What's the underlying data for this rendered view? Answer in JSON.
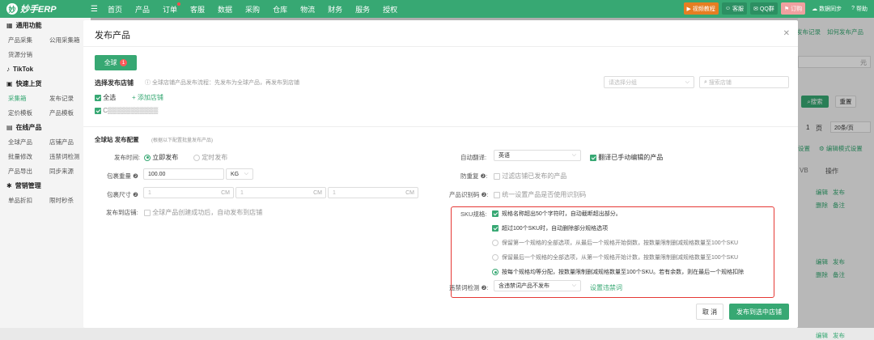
{
  "app": {
    "logo_text": "妙手ERP",
    "logo_mark": "妙"
  },
  "topnav": [
    "首页",
    "产品",
    "订单",
    "客服",
    "数据",
    "采购",
    "仓库",
    "物流",
    "财务",
    "服务",
    "授权"
  ],
  "topright": {
    "video": "视频教程",
    "kefu": "客服",
    "qq": "QQ群",
    "order": "订购",
    "sync": "数据同步",
    "help": "帮助"
  },
  "sidebar": {
    "rows": [
      {
        "type": "sec",
        "label": "通用功能",
        "icon": "grid-icon"
      },
      {
        "type": "row",
        "a": "产品采集",
        "b": "公用采集箱"
      },
      {
        "type": "row",
        "a": "货源分销",
        "b": ""
      },
      {
        "type": "sec",
        "label": "TikTok",
        "icon": "tiktok-icon"
      },
      {
        "type": "sec",
        "label": "快速上货",
        "icon": "store-icon"
      },
      {
        "type": "row",
        "a": "采集箱",
        "b": "发布记录",
        "active": true
      },
      {
        "type": "row",
        "a": "定价模板",
        "b": "产品模板"
      },
      {
        "type": "sec",
        "label": "在线产品",
        "icon": "box-icon"
      },
      {
        "type": "row",
        "a": "全球产品",
        "b": "店铺产品"
      },
      {
        "type": "row",
        "a": "批量修改",
        "b": "违禁词检测"
      },
      {
        "type": "row",
        "a": "产品导出",
        "b": "同步来源"
      },
      {
        "type": "sec",
        "label": "营销管理",
        "icon": "marketing-icon"
      },
      {
        "type": "row",
        "a": "单品折扣",
        "b": "限时秒杀"
      }
    ]
  },
  "bgright": {
    "records": "发布记录",
    "howto": "如何发布产品",
    "unit": "元",
    "search": "搜索",
    "reset": "重置",
    "page": "1",
    "page_unit": "页",
    "per_page": "20条/页",
    "settings": "设置",
    "edit_mode": "编辑模式设置",
    "op_col": "操作",
    "col_v": "VB",
    "actions": [
      [
        "编辑",
        "发布"
      ],
      [
        "删除",
        "备注"
      ]
    ]
  },
  "modal": {
    "title": "发布产品",
    "tab_label": "全球",
    "tab_badge": "1",
    "shop_section_label": "选择发布店铺",
    "shop_hint": "全球店铺产品发布流程：先发布为全球产品，再发布到店铺",
    "group_placeholder": "请选择分组",
    "shop_search_placeholder": "搜索店铺",
    "select_all": "全选",
    "add_shop": "+ 添加店铺",
    "shop_name": "C▒▒▒▒▒▒▒▒▒▒▒",
    "config_title": "全球站 发布配置",
    "config_hint": "(根据以下配置批量发布产品)",
    "publish_time_label": "发布时间:",
    "publish_now": "立即发布",
    "publish_scheduled": "定时发布",
    "weight_label": "包裹重量",
    "weight_value": "100.00",
    "weight_unit": "KG",
    "size_label": "包裹尺寸",
    "size_unit": "CM",
    "size_placeholder": "1",
    "to_shop_label": "发布到店铺:",
    "to_shop_text": "全球产品创建成功后，自动发布到店铺",
    "auto_translate_label": "自动翻译:",
    "auto_translate_value": "英语",
    "translate_manual": "翻译已手动编辑的产品",
    "anti_dup_label": "防重复",
    "anti_dup_text": "过滤店铺已发布的产品",
    "product_code_label": "产品识别码",
    "product_code_text": "统一设置产品是否使用识别码",
    "sku_label": "SKU规格:",
    "sku_options": [
      {
        "kind": "cb",
        "on": true,
        "text": "规格名称超出50个字符时，自动截断超出部分。"
      },
      {
        "kind": "cb",
        "on": true,
        "text": "超过100个SKU时，自动删除部分规格选项"
      },
      {
        "kind": "rd",
        "on": false,
        "text": "保留第一个规格的全部选项，从最后一个规格开始倒数，按数量限制删减规格数量至100个SKU"
      },
      {
        "kind": "rd",
        "on": false,
        "text": "保留最后一个规格的全部选项，从第一个规格开始计数，按数量限制删减规格数量至100个SKU"
      },
      {
        "kind": "rd",
        "on": true,
        "text": "按每个规格均等分配，按数量限制删减规格数量至100个SKU。若有余数，则在最后一个规格扣除"
      }
    ],
    "forbidden_label": "违禁词检测",
    "forbidden_value": "含违禁词产品不发布",
    "forbidden_link": "设置违禁词",
    "cancel": "取 消",
    "publish_btn": "发布到选中店铺"
  }
}
